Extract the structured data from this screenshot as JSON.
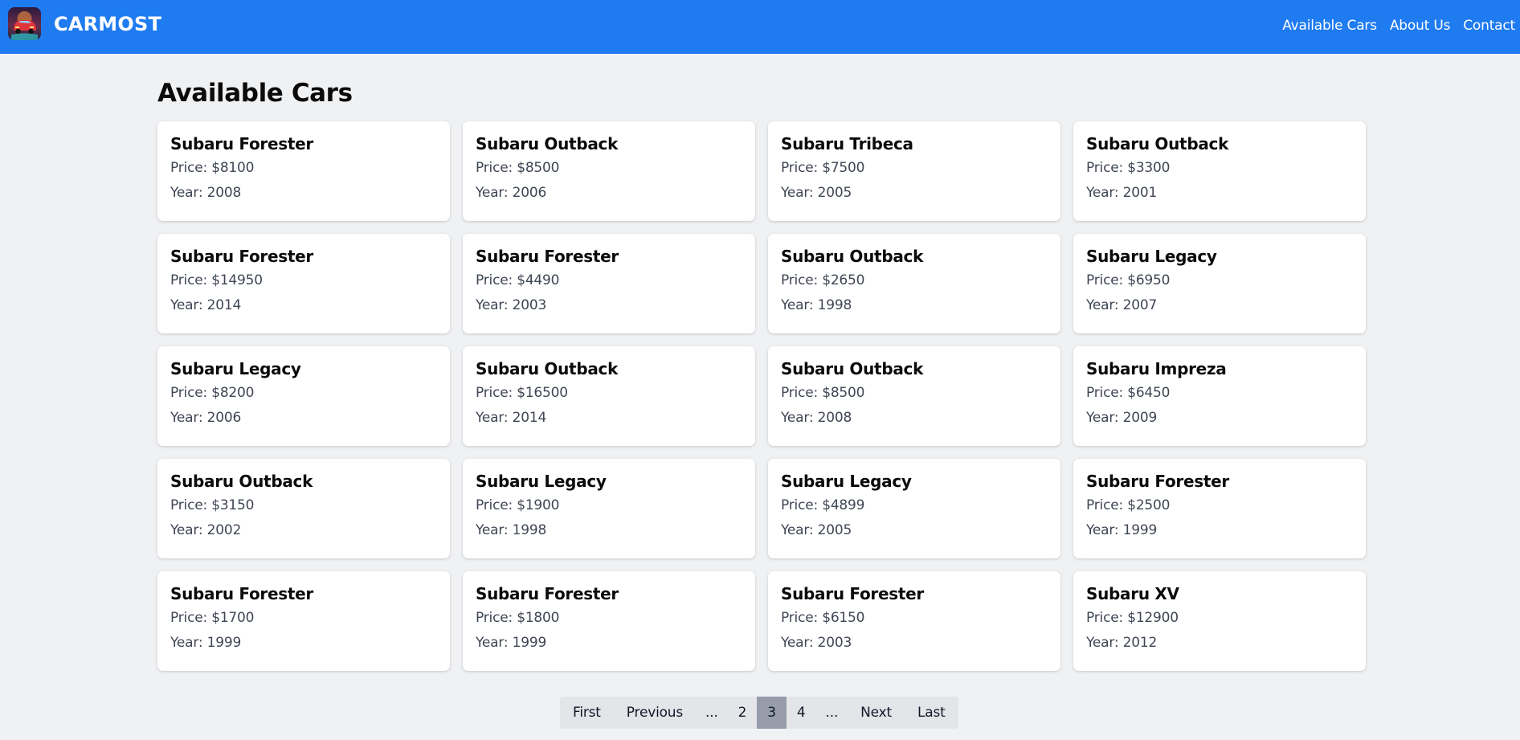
{
  "header": {
    "brand": "CARMOST",
    "nav": [
      {
        "label": "Available Cars"
      },
      {
        "label": "About Us"
      },
      {
        "label": "Contact"
      }
    ]
  },
  "main": {
    "title": "Available Cars",
    "cars": [
      {
        "name": "Subaru Forester",
        "price": "Price: $8100",
        "year": "Year: 2008"
      },
      {
        "name": "Subaru Outback",
        "price": "Price: $8500",
        "year": "Year: 2006"
      },
      {
        "name": "Subaru Tribeca",
        "price": "Price: $7500",
        "year": "Year: 2005"
      },
      {
        "name": "Subaru Outback",
        "price": "Price: $3300",
        "year": "Year: 2001"
      },
      {
        "name": "Subaru Forester",
        "price": "Price: $14950",
        "year": "Year: 2014"
      },
      {
        "name": "Subaru Forester",
        "price": "Price: $4490",
        "year": "Year: 2003"
      },
      {
        "name": "Subaru Outback",
        "price": "Price: $2650",
        "year": "Year: 1998"
      },
      {
        "name": "Subaru Legacy",
        "price": "Price: $6950",
        "year": "Year: 2007"
      },
      {
        "name": "Subaru Legacy",
        "price": "Price: $8200",
        "year": "Year: 2006"
      },
      {
        "name": "Subaru Outback",
        "price": "Price: $16500",
        "year": "Year: 2014"
      },
      {
        "name": "Subaru Outback",
        "price": "Price: $8500",
        "year": "Year: 2008"
      },
      {
        "name": "Subaru Impreza",
        "price": "Price: $6450",
        "year": "Year: 2009"
      },
      {
        "name": "Subaru Outback",
        "price": "Price: $3150",
        "year": "Year: 2002"
      },
      {
        "name": "Subaru Legacy",
        "price": "Price: $1900",
        "year": "Year: 1998"
      },
      {
        "name": "Subaru Legacy",
        "price": "Price: $4899",
        "year": "Year: 2005"
      },
      {
        "name": "Subaru Forester",
        "price": "Price: $2500",
        "year": "Year: 1999"
      },
      {
        "name": "Subaru Forester",
        "price": "Price: $1700",
        "year": "Year: 1999"
      },
      {
        "name": "Subaru Forester",
        "price": "Price: $1800",
        "year": "Year: 1999"
      },
      {
        "name": "Subaru Forester",
        "price": "Price: $6150",
        "year": "Year: 2003"
      },
      {
        "name": "Subaru XV",
        "price": "Price: $12900",
        "year": "Year: 2012"
      }
    ]
  },
  "pagination": {
    "items": [
      {
        "label": "First",
        "kind": "nav"
      },
      {
        "label": "Previous",
        "kind": "nav"
      },
      {
        "label": "...",
        "kind": "sep"
      },
      {
        "label": "2",
        "kind": "num"
      },
      {
        "label": "3",
        "kind": "num",
        "active": true
      },
      {
        "label": "4",
        "kind": "num"
      },
      {
        "label": "...",
        "kind": "sep"
      },
      {
        "label": "Next",
        "kind": "nav"
      },
      {
        "label": "Last",
        "kind": "nav"
      }
    ]
  },
  "colors": {
    "header_bg": "#1f7bf0",
    "page_bg": "#f0f1f3",
    "active_page": "#969caa"
  }
}
